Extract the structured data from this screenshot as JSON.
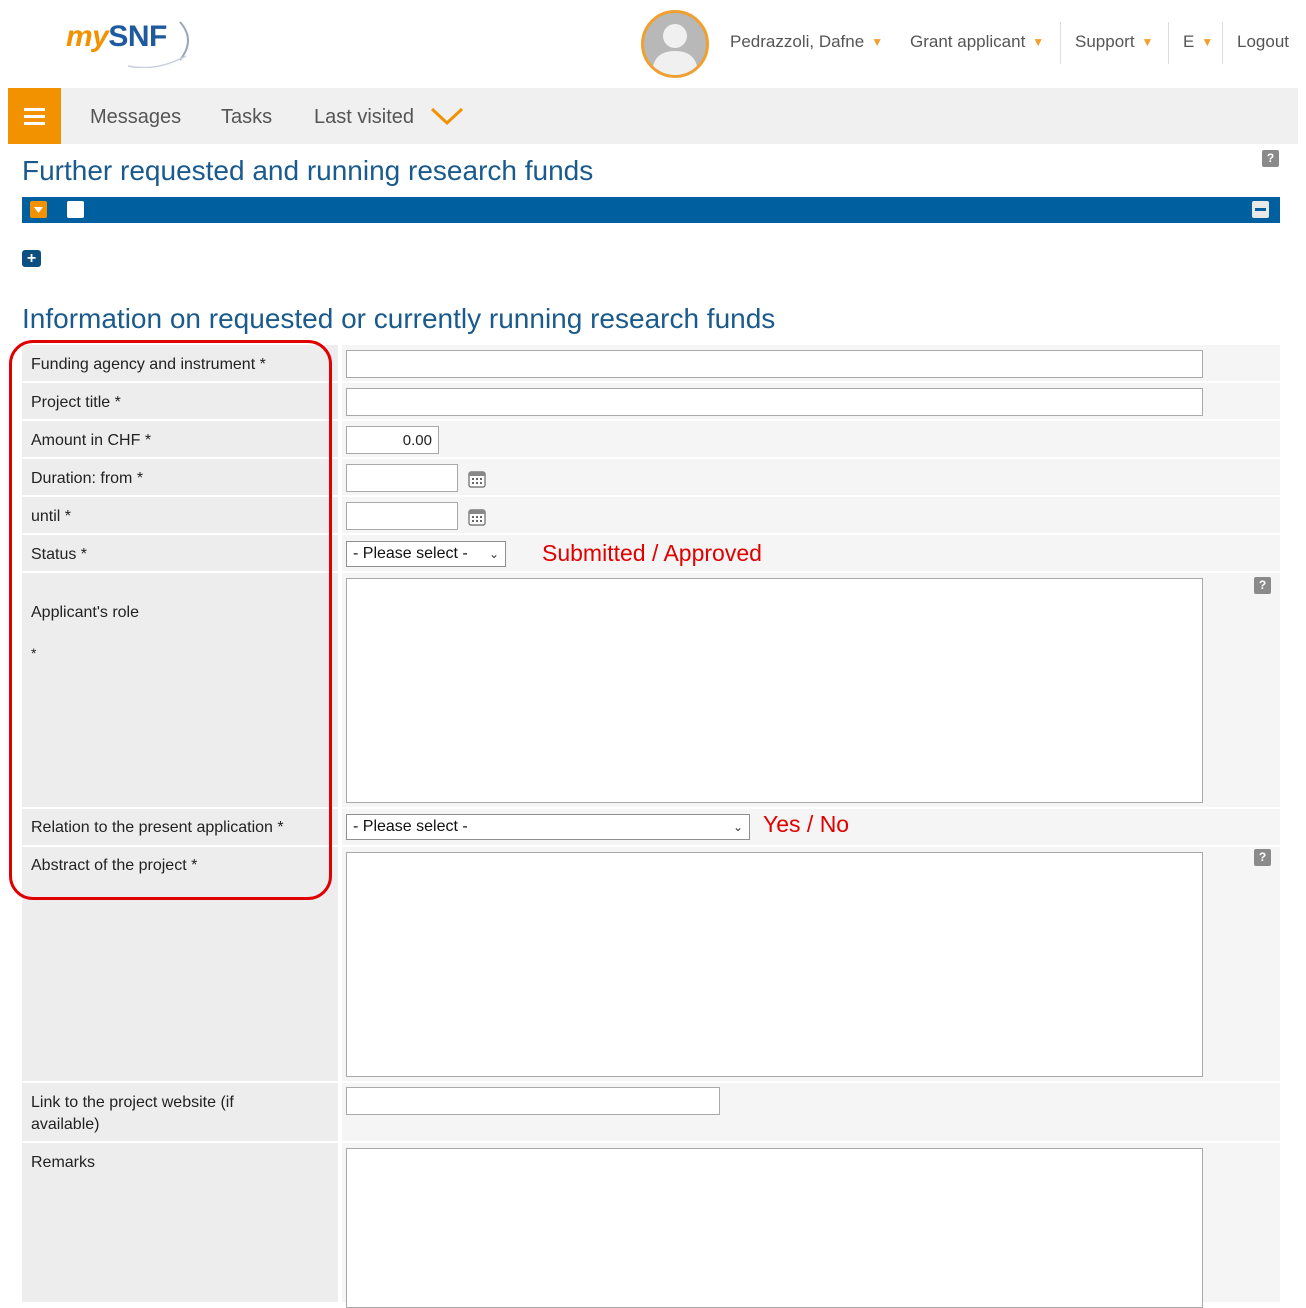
{
  "header": {
    "logo_my": "my",
    "logo_snf": "SNF",
    "user": "Pedrazzoli, Dafne",
    "role": "Grant applicant",
    "support": "Support",
    "lang": "E",
    "logout": "Logout"
  },
  "menu": {
    "messages": "Messages",
    "tasks": "Tasks",
    "last_visited": "Last visited"
  },
  "page": {
    "title": "Further requested and running research funds",
    "section_title": "Information on requested or currently running research funds"
  },
  "form": {
    "funding_label": "Funding agency and instrument *",
    "project_title_label": "Project title *",
    "amount_label": "Amount in CHF *",
    "amount_value": "0.00",
    "duration_from_label": "Duration: from *",
    "until_label": "until *",
    "status_label": "Status *",
    "status_selected": "- Please select -",
    "role_label": "Applicant's role",
    "role_star": "*",
    "relation_label": "Relation to the present application *",
    "relation_selected": "- Please select -",
    "abstract_label": "Abstract of the project *",
    "website_label_1": "Link to the project website (if",
    "website_label_2": "available)",
    "remarks_label": "Remarks"
  },
  "annotations": {
    "status_note": "Submitted / Approved",
    "relation_note": "Yes / No",
    "color": "#e00000"
  },
  "colors": {
    "accent_orange": "#f39200",
    "brand_blue": "#005f9e",
    "title_blue": "#1a5a8c"
  }
}
